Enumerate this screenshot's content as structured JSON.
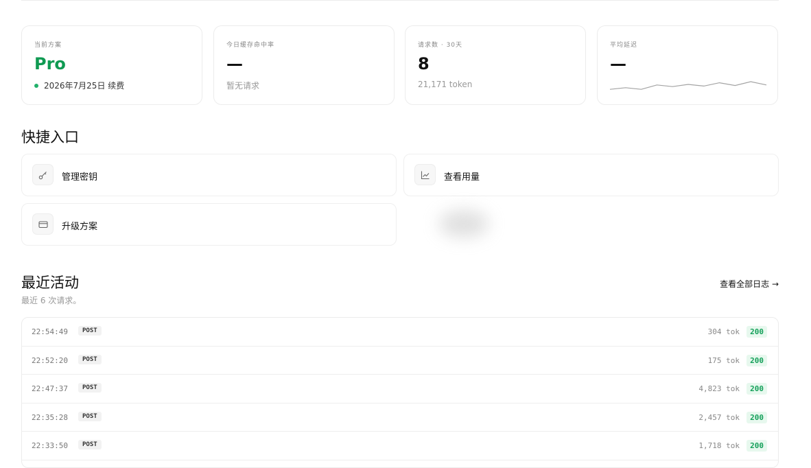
{
  "stats": [
    {
      "label": "当前方案",
      "value": "Pro",
      "sub": "2026年7月25日 续费"
    },
    {
      "label": "今日缓存命中率",
      "value": "—",
      "sub": "暂无请求"
    },
    {
      "label": "请求数 · 30天",
      "value": "8",
      "sub": "21,171 token"
    },
    {
      "label": "平均延迟",
      "value": "—",
      "sparkline": [
        0.3,
        0.45,
        0.3,
        0.7,
        0.55,
        0.75,
        0.6,
        0.9,
        0.65,
        1.0,
        0.7
      ]
    }
  ],
  "quick_access": {
    "title": "快捷入口",
    "items": [
      {
        "label": "管理密钥",
        "icon": "key-icon"
      },
      {
        "label": "查看用量",
        "icon": "line-chart-icon"
      },
      {
        "label": "升级方案",
        "icon": "credit-card-icon"
      }
    ]
  },
  "activity": {
    "title": "最近活动",
    "subtitle": "最近 6 次请求。",
    "view_all": "查看全部日志 →",
    "rows": [
      {
        "time": "22:54:49",
        "method": "POST",
        "tokens": "304 tok",
        "status": "200"
      },
      {
        "time": "22:52:20",
        "method": "POST",
        "tokens": "175 tok",
        "status": "200"
      },
      {
        "time": "22:47:37",
        "method": "POST",
        "tokens": "4,823 tok",
        "status": "200"
      },
      {
        "time": "22:35:28",
        "method": "POST",
        "tokens": "2,457 tok",
        "status": "200"
      },
      {
        "time": "22:33:50",
        "method": "POST",
        "tokens": "1,718 tok",
        "status": "200"
      }
    ]
  },
  "colors": {
    "accent_green": "#0f9a52",
    "status_green": "#15a05a",
    "border": "#ececec"
  }
}
